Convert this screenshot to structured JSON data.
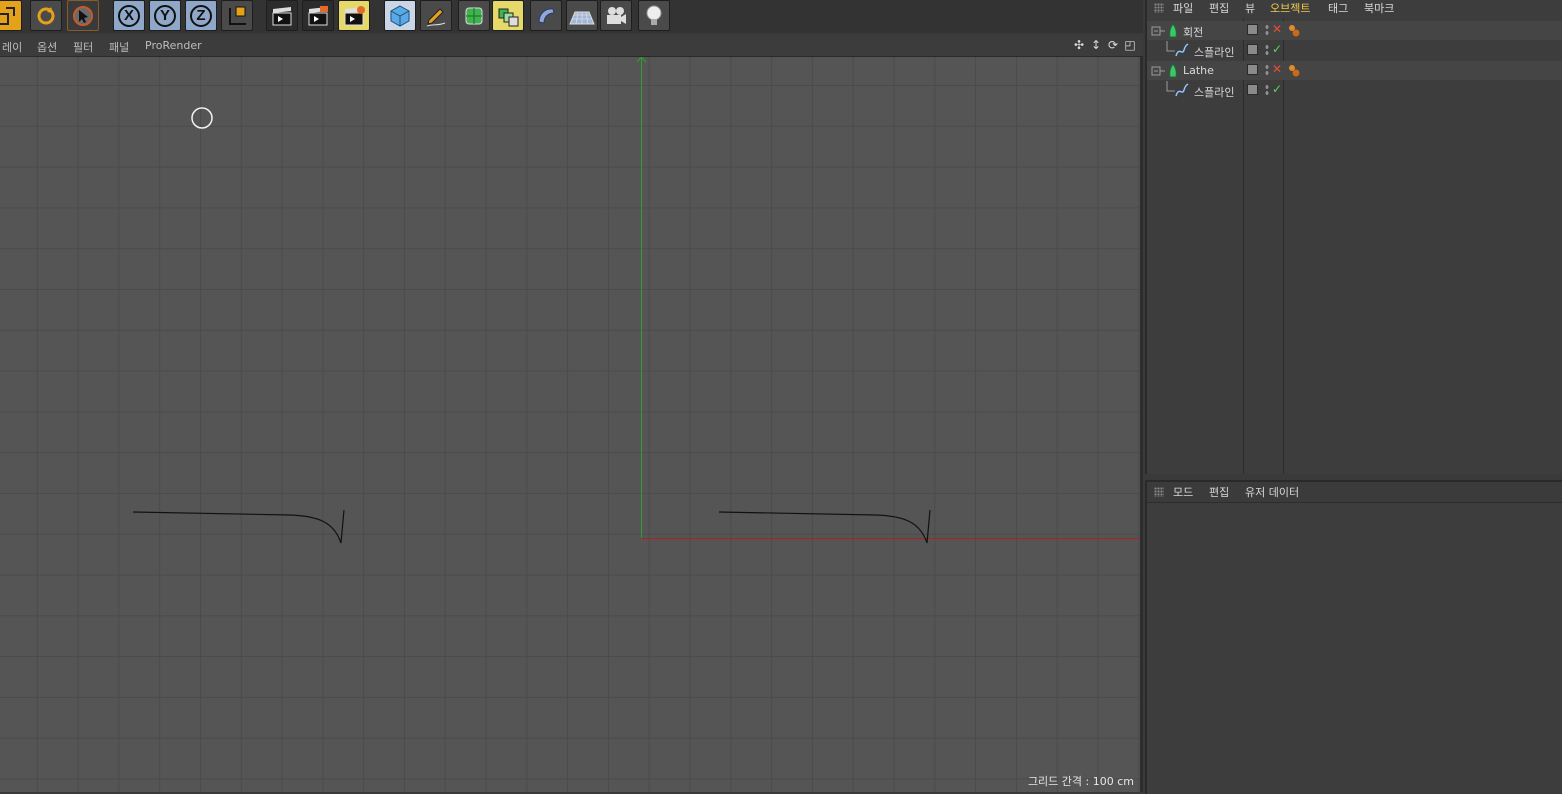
{
  "toolbar": {
    "axis_x": "X",
    "axis_y": "Y",
    "axis_z": "Z"
  },
  "viewport": {
    "menu": [
      "레이",
      "옵션",
      "필터",
      "패널",
      "ProRender"
    ],
    "grid_spacing": "그리드 간격 : 100 cm"
  },
  "object_manager": {
    "menu": [
      "파일",
      "편집",
      "뷰",
      "오브젝트",
      "태그",
      "북마크"
    ],
    "highlighted_menu": "오브젝트",
    "objects": [
      {
        "name": "회전",
        "level": 0,
        "status": "x"
      },
      {
        "name": "스플라인",
        "level": 1,
        "status": "ok"
      },
      {
        "name": "Lathe",
        "level": 0,
        "status": "x"
      },
      {
        "name": "스플라인",
        "level": 1,
        "status": "ok"
      }
    ]
  },
  "attribute_manager": {
    "menu": [
      "모드",
      "편집",
      "유저 데이터"
    ]
  },
  "colors": {
    "y_axis": "#2ea02e",
    "x_axis": "#b02020",
    "accent": "#f2c94c"
  }
}
